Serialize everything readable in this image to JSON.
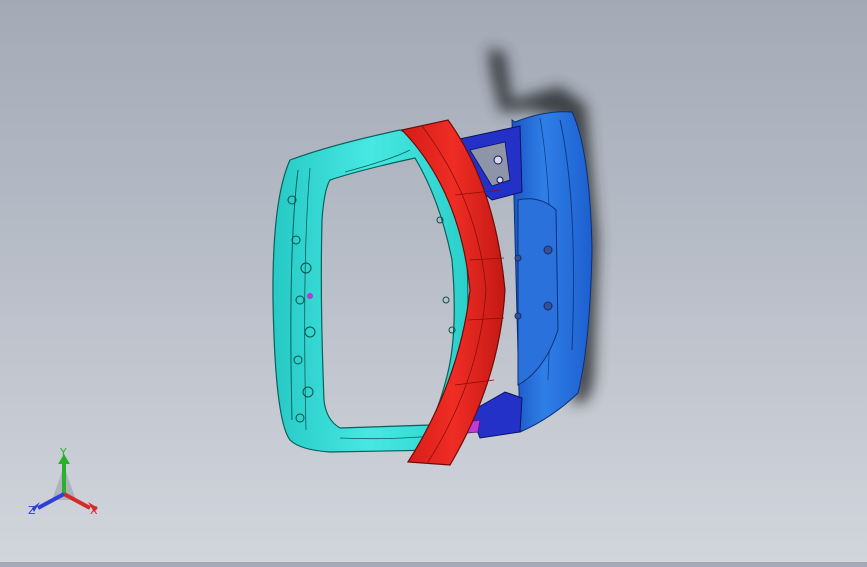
{
  "triad": {
    "x_label": "X",
    "y_label": "Y",
    "z_label": "Z",
    "x_color": "#d42a2a",
    "y_color": "#2bb02b",
    "z_color": "#2f3fd8"
  },
  "model": {
    "frame_color": "#3fe0db",
    "seal_color": "#e8261f",
    "panel_color": "#2d79e0",
    "bracket_color": "#2431c8"
  }
}
